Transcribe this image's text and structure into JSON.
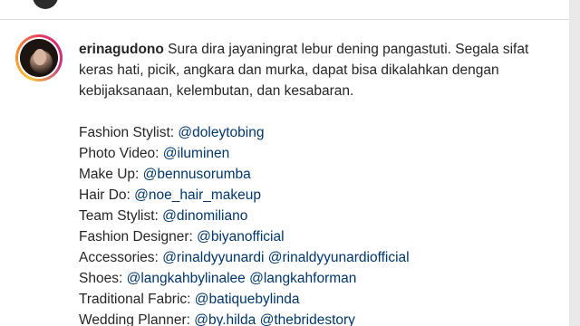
{
  "post": {
    "username": "erinagudono",
    "caption_text": "Sura dira jayaningrat lebur dening pangastuti. Segala sifat keras hati, picik, angkara dan murka, dapat bisa dikalahkan dengan kebijaksanaan, kelembutan, dan kesabaran."
  },
  "credits": [
    {
      "role": "Fashion Stylist:",
      "mentions": [
        "@doleytobing"
      ]
    },
    {
      "role": "Photo Video:",
      "mentions": [
        "@iluminen"
      ]
    },
    {
      "role": "Make Up:",
      "mentions": [
        "@bennusorumba"
      ]
    },
    {
      "role": "Hair Do:",
      "mentions": [
        "@noe_hair_makeup"
      ]
    },
    {
      "role": "Team Stylist:",
      "mentions": [
        "@dinomiliano"
      ]
    },
    {
      "role": "Fashion Designer:",
      "mentions": [
        "@biyanofficial"
      ]
    },
    {
      "role": "Accessories:",
      "mentions": [
        "@rinaldyyunardi",
        "@rinaldyyunardiofficial"
      ]
    },
    {
      "role": "Shoes:",
      "mentions": [
        "@langkahbylinalee",
        "@langkahforman"
      ]
    },
    {
      "role": "Traditional Fabric:",
      "mentions": [
        "@batiquebylinda"
      ]
    },
    {
      "role": "Wedding Planner:",
      "mentions": [
        "@by.hilda",
        "@thebridestory"
      ]
    }
  ],
  "colors": {
    "text": "#262626",
    "mention": "#00376b",
    "story_ring_start": "#f9c33b",
    "story_ring_end": "#c13584"
  },
  "icons": {
    "avatar": "profile-photo"
  }
}
